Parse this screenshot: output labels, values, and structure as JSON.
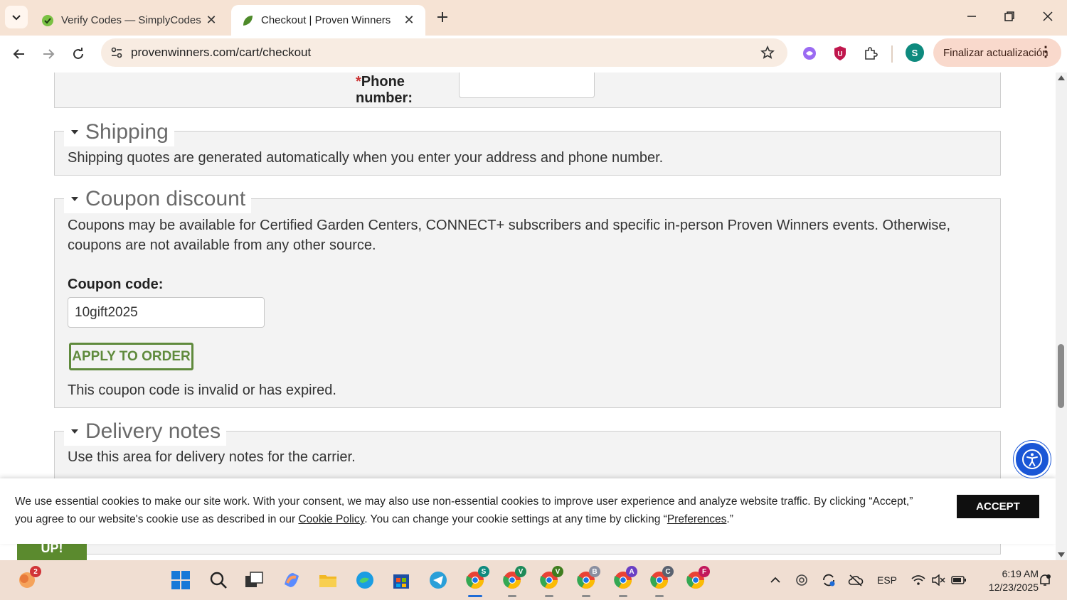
{
  "browser": {
    "tabs": [
      {
        "title": "Verify Codes — SimplyCodes",
        "active": false
      },
      {
        "title": "Checkout | Proven Winners",
        "active": true
      }
    ],
    "url": "provenwinners.com/cart/checkout",
    "profile_initial": "S",
    "update_button_label": "Finalizar actualización"
  },
  "page": {
    "phone_label": "Phone number:",
    "phone_required_mark": "*",
    "shipping": {
      "legend": "Shipping",
      "text": "Shipping quotes are generated automatically when you enter your address and phone number."
    },
    "coupon": {
      "legend": "Coupon discount",
      "text": "Coupons may be available for Certified Garden Centers, CONNECT+ subscribers and specific in-person Proven Winners events. Otherwise, coupons are not available from any other source.",
      "code_label": "Coupon code:",
      "code_value": "10gift2025",
      "apply_label": "APPLY TO ORDER",
      "error_message": "This coupon code is invalid or has expired."
    },
    "delivery": {
      "legend": "Delivery notes",
      "text": "Use this area for delivery notes for the carrier."
    },
    "partial_button_label": "UP!"
  },
  "cookie_banner": {
    "text_part1": "We use essential cookies to make our site work. With your consent, we may also use non-essential cookies to improve user experience and analyze website traffic. By clicking “Accept,” you agree to our website's cookie use as described in our ",
    "cookie_policy_link": "Cookie Policy",
    "text_part2": ". You can change your cookie settings at any time by clicking “",
    "preferences_link": "Preferences",
    "text_part3": ".”",
    "accept_label": "ACCEPT"
  },
  "taskbar": {
    "weather_badge": "2",
    "chrome_profiles": [
      "S",
      "V",
      "V",
      "B",
      "A",
      "C",
      "F"
    ],
    "language": "ESP",
    "time": "6:19 AM",
    "date": "12/23/2025"
  },
  "colors": {
    "accent_green": "#5f8a3c",
    "tab_bar": "#f6e3d4",
    "accept_button": "#0f0f0f",
    "accessibility_button": "#1a56d6"
  },
  "icons": [
    "tab-search-icon",
    "simplycodes-icon",
    "leaf-icon",
    "close-icon",
    "plus-icon",
    "minimize-icon",
    "restore-icon",
    "back-icon",
    "forward-icon",
    "reload-icon",
    "site-settings-icon",
    "star-icon",
    "extension-icon",
    "accessibility-icon",
    "windows-start-icon",
    "search-icon"
  ]
}
